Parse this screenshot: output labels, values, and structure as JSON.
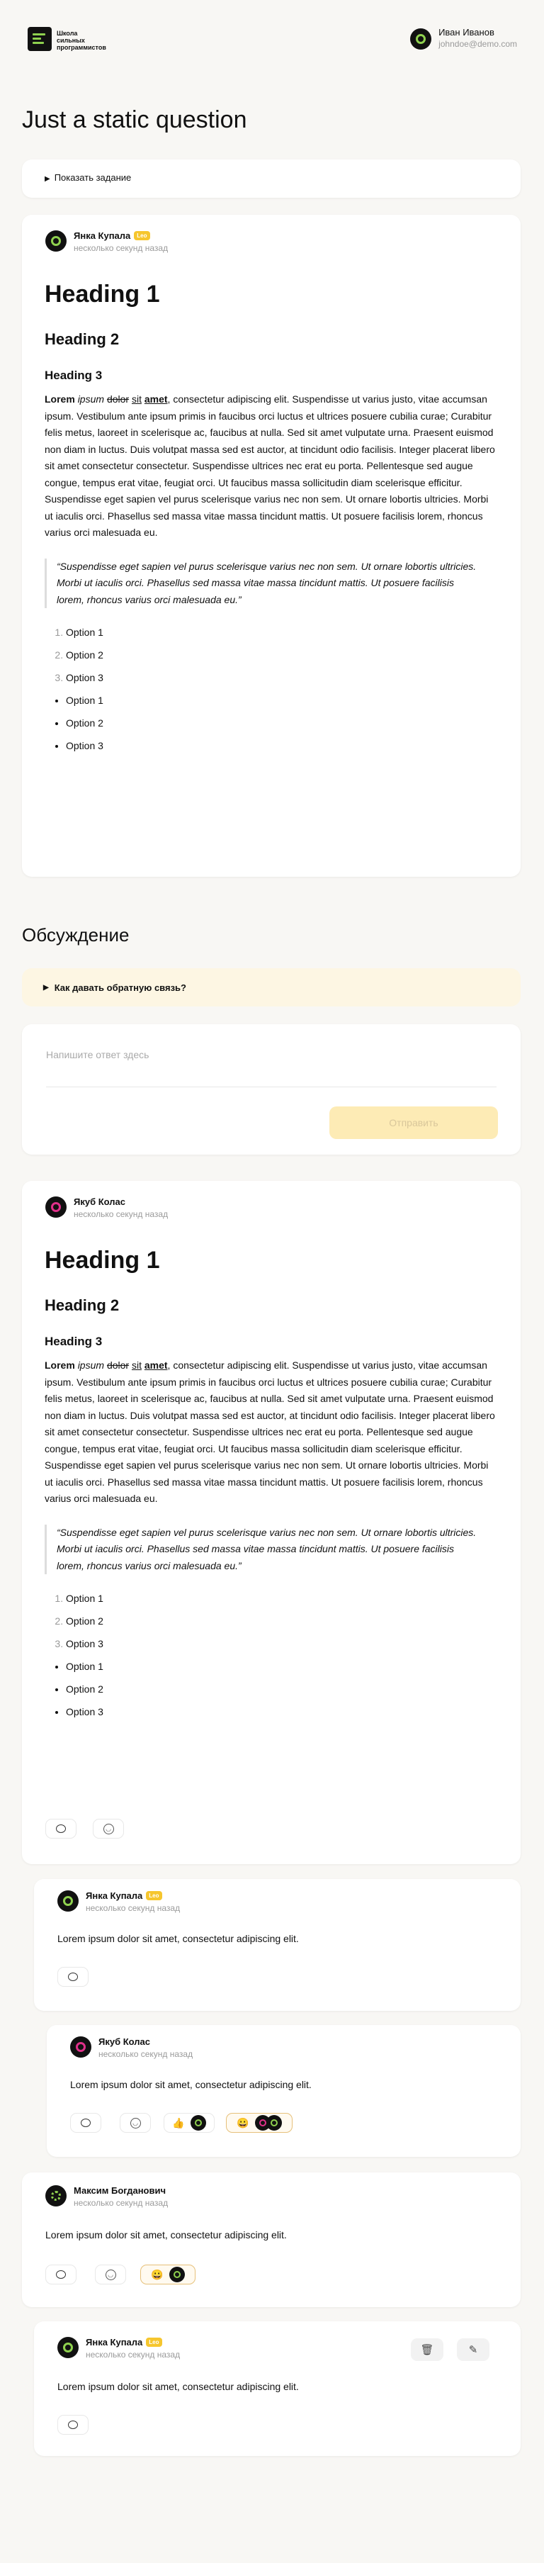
{
  "brand": {
    "text": "Школа\nсильных\nпрограммистов"
  },
  "user": {
    "name": "Иван Иванов",
    "email": "johndoe@demo.com"
  },
  "page": {
    "title": "Just a static question"
  },
  "task_toggle": {
    "label": "Показать задание"
  },
  "question": {
    "author": "Янка Купала",
    "badge": "Leo",
    "time": "несколько секунд назад",
    "h1": "Heading 1",
    "h2": "Heading 2",
    "h3": "Heading 3",
    "p_w1": "Lorem",
    "p_w2": "ipsum",
    "p_w3": "dolor",
    "p_w4": "sit",
    "p_w5": "amet",
    "p_rest": ", consectetur adipiscing elit. Suspendisse ut varius justo, vitae accumsan ipsum. Vestibulum ante ipsum primis in faucibus orci luctus et ultrices posuere cubilia curae; Curabitur felis metus, laoreet in scelerisque ac, faucibus at nulla. Sed sit amet vulputate urna. Praesent euismod non diam in luctus. Duis volutpat massa sed est auctor, at tincidunt odio facilisis. Integer placerat libero sit amet consectetur consectetur. Suspendisse ultrices nec erat eu porta. Pellentesque sed augue congue, tempus erat vitae, feugiat orci. Ut faucibus massa sollicitudin diam scelerisque efficitur. Suspendisse eget sapien vel purus scelerisque varius nec non sem. Ut ornare lobortis ultricies. Morbi ut iaculis orci. Phasellus sed massa vitae massa tincidunt mattis. Ut posuere facilisis lorem, rhoncus varius orci malesuada eu.",
    "quote": "“Suspendisse eget sapien vel purus scelerisque varius nec non sem. Ut ornare lobortis ultricies. Morbi ut iaculis orci. Phasellus sed massa vitae massa tincidunt mattis. Ut posuere facilisis lorem, rhoncus varius orci malesuada eu.”",
    "ol": [
      "Option 1",
      "Option 2",
      "Option 3"
    ],
    "ul": [
      "Option 1",
      "Option 2",
      "Option 3"
    ]
  },
  "discussion": {
    "title": "Обсуждение",
    "feedback_label": "Как давать обратную связь?",
    "answer_placeholder": "Напишите ответ здесь",
    "submit_label": "Отправить"
  },
  "comments": {
    "c1": {
      "author": "Якуб Колас",
      "time": "несколько секунд назад"
    },
    "c2": {
      "author": "Янка Купала",
      "badge": "Leo",
      "time": "несколько секунд назад",
      "text": "Lorem ipsum dolor sit amet, consectetur adipiscing elit."
    },
    "c3": {
      "author": "Якуб Колас",
      "time": "несколько секунд назад",
      "text": "Lorem ipsum dolor sit amet, consectetur adipiscing elit.",
      "reactions": [
        {
          "emoji": "👍"
        },
        {
          "emoji": "😀"
        }
      ]
    },
    "c4": {
      "author": "Максим Богданович",
      "time": "несколько секунд назад",
      "text": "Lorem ipsum dolor sit amet, consectetur adipiscing elit.",
      "reactions": [
        {
          "emoji": "😀"
        }
      ]
    },
    "c5": {
      "author": "Янка Купала",
      "badge": "Leo",
      "time": "несколько секунд назад",
      "text": "Lorem ipsum dolor sit amet, consectetur adipiscing elit."
    }
  },
  "icons": {
    "delete": "trash-icon",
    "edit": "pencil-icon",
    "reply": "comment-bubble-icon",
    "react": "emoji-smile-icon"
  },
  "colors": {
    "accent": "#f6c62e",
    "submit_bg": "#fdebb5",
    "feedback_bg": "#fdf6e3",
    "avatar_ring": "#8fd14f",
    "avatar_pink": "#e0308a"
  }
}
